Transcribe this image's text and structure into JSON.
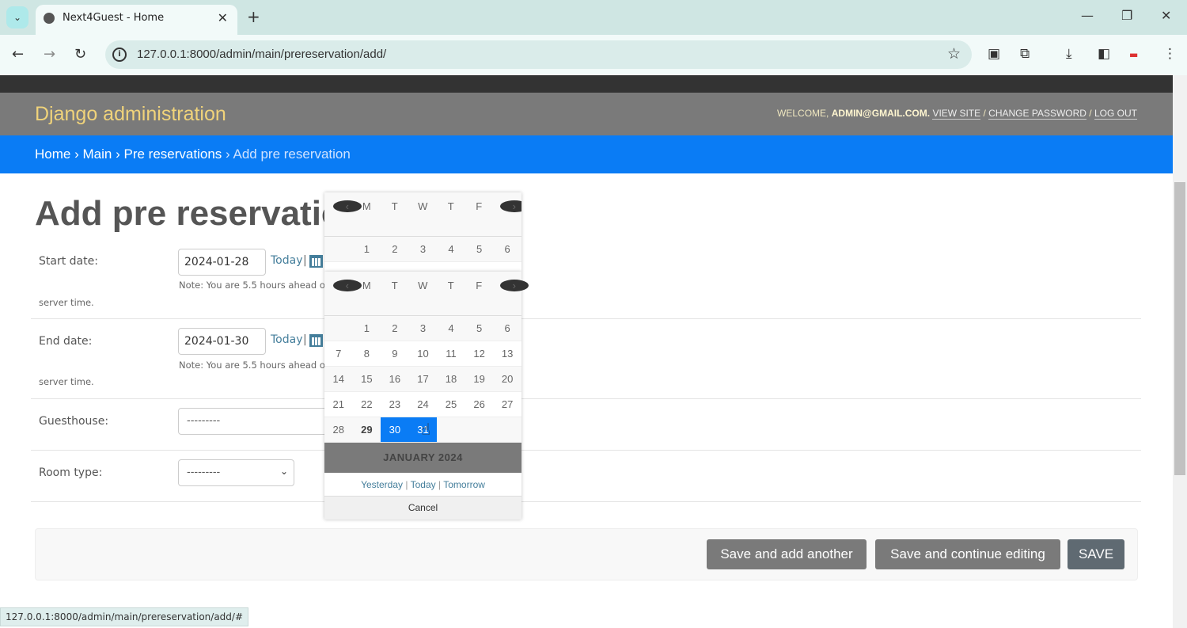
{
  "browser": {
    "tab_title": "Next4Guest - Home",
    "url": "127.0.0.1:8000/admin/main/prereservation/add/",
    "status_url": "127.0.0.1:8000/admin/main/prereservation/add/#"
  },
  "header": {
    "brand": "Django administration",
    "welcome": "WELCOME,",
    "user": "ADMIN@GMAIL.COM.",
    "view_site": "VIEW SITE",
    "change_password": "CHANGE PASSWORD",
    "log_out": "LOG OUT",
    "sep": "/"
  },
  "breadcrumbs": {
    "home": "Home",
    "main": "Main",
    "list": "Pre reservations",
    "current": "Add pre reservation",
    "sep": "›"
  },
  "page_title": "Add pre reservation",
  "form": {
    "start_label": "Start date:",
    "start_value": "2024-01-28",
    "end_label": "End date:",
    "end_value": "2024-01-30",
    "today": "Today",
    "pipe": "|",
    "note_a": "Note: You are 5.5 hours ahead of",
    "note_b": "server time.",
    "guesthouse_label": "Guesthouse:",
    "guesthouse_value": "---------",
    "roomtype_label": "Room type:",
    "roomtype_value": "---------"
  },
  "buttons": {
    "save_add": "Save and add another",
    "save_continue": "Save and continue editing",
    "save": "SAVE"
  },
  "calendar": {
    "weekdays": [
      "M",
      "T",
      "W",
      "T",
      "F"
    ],
    "weeks": [
      [
        "",
        "1",
        "2",
        "3",
        "4",
        "5",
        "6"
      ],
      [
        "7",
        "8",
        "9",
        "10",
        "11",
        "12",
        "13"
      ],
      [
        "14",
        "15",
        "16",
        "17",
        "18",
        "19",
        "20"
      ],
      [
        "21",
        "22",
        "23",
        "24",
        "25",
        "26",
        "27"
      ],
      [
        "28",
        "29",
        "30",
        "31",
        "",
        "",
        ""
      ]
    ],
    "today": "29",
    "selected": [
      "30",
      "31"
    ],
    "caption": "JANUARY 2024",
    "yesterday": "Yesterday",
    "today_link": "Today",
    "tomorrow": "Tomorrow",
    "cancel": "Cancel"
  },
  "colors": {
    "breadcrumb_bg": "#0a7cf5",
    "header_bg": "#7a7a7a",
    "brand": "#f0d37a",
    "selected_day": "#0a7cf5"
  }
}
